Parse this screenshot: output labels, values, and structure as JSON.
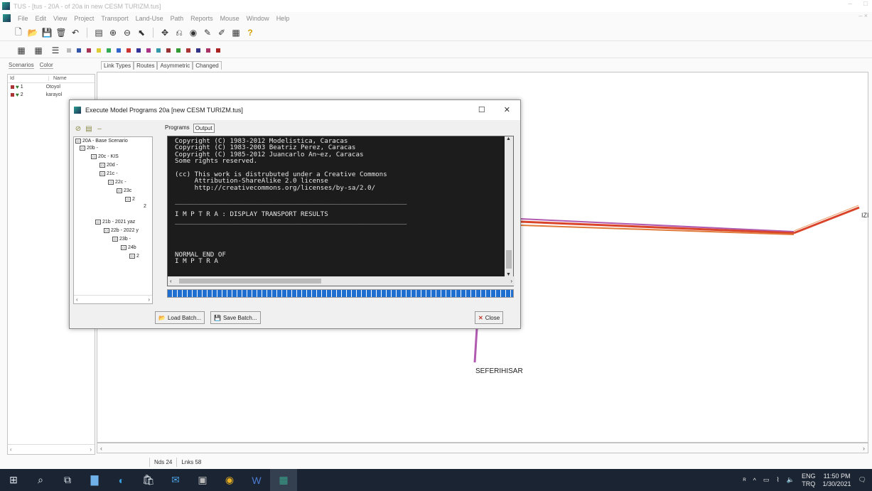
{
  "window": {
    "title": "TUS - [tus - 20A - of 20a in new CESM TURIZM.tus]"
  },
  "menu": [
    "File",
    "Edit",
    "View",
    "Project",
    "Transport",
    "Land-Use",
    "Path",
    "Reports",
    "Mouse",
    "Window",
    "Help"
  ],
  "left_panel": {
    "tabs": [
      "Scenarios",
      "Color"
    ],
    "columns": [
      "Id",
      "Name"
    ],
    "rows": [
      {
        "id": "1",
        "name": "Otoyol"
      },
      {
        "id": "2",
        "name": "karayol"
      }
    ]
  },
  "map_tabs": [
    "Link Types",
    "Routes",
    "Asymmetric",
    "Changed"
  ],
  "map": {
    "labels": {
      "seferihisar": "SEFERIHISAR",
      "izmir": "IZI"
    }
  },
  "status": {
    "nodes": "Nds 24",
    "links": "Lnks 58"
  },
  "dialog": {
    "title": "Execute Model Programs  20a [new CESM TURIZM.tus]",
    "tabs": [
      "Programs",
      "Output"
    ],
    "active_tab": "Output",
    "tree": [
      {
        "label": "20A - Base Scenario"
      },
      {
        "label": "20b -"
      },
      {
        "label": "20c - KIS"
      },
      {
        "label": "20d -"
      },
      {
        "label": "21c -"
      },
      {
        "label": "22c -"
      },
      {
        "label": "23c"
      },
      {
        "label": "2"
      },
      {
        "label": "2"
      },
      {
        "label": "21b - 2021 yaz"
      },
      {
        "label": "22b - 2022 y"
      },
      {
        "label": "23b -"
      },
      {
        "label": "24b"
      },
      {
        "label": "2"
      }
    ],
    "console_lines": [
      "Copyright (C) 1983-2012 Modelistica, Caracas",
      "Copyright (C) 1983-2003 Beatriz Perez, Caracas",
      "Copyright (C) 1985-2012 Juancarlo An~ez, Caracas",
      "Some rights reserved.",
      "",
      "(cc) This work is distrubuted under a Creative Commons",
      "     Attribution-ShareAlike 2.0 license",
      "     http://creativecommons.org/licenses/by-sa/2.0/",
      "",
      "___________________________________________________________",
      "",
      "I M P T R A : DISPLAY TRANSPORT RESULTS",
      "___________________________________________________________",
      "",
      "",
      "",
      "",
      "NORMAL END OF",
      "I M P T R A"
    ],
    "progress": 1.0,
    "buttons": {
      "load": "Load Batch...",
      "save": "Save Batch...",
      "close": "Close"
    }
  },
  "taskbar": {
    "tray": {
      "lang1": "ENG",
      "lang2": "TRQ",
      "time": "11:50 PM",
      "date": "1/30/2021"
    }
  },
  "colors": {
    "link_red": "#d9442a",
    "link_purple": "#b05ab0",
    "progress_blue": "#1e6fd0",
    "taskbar": "#1b2433"
  }
}
